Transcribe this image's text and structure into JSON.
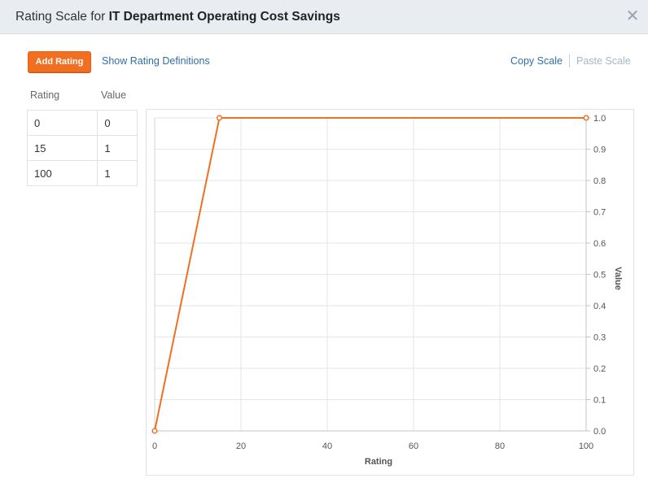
{
  "dialog": {
    "title_prefix": "Rating Scale for ",
    "title_bold": "IT Department Operating Cost Savings",
    "close_glyph": "✕"
  },
  "toolbar": {
    "add_rating_label": "Add Rating",
    "show_definitions_label": "Show Rating Definitions",
    "copy_scale_label": "Copy Scale",
    "paste_scale_label": "Paste Scale"
  },
  "table": {
    "headers": [
      "Rating",
      "Value"
    ],
    "rows": [
      {
        "rating": "0",
        "value": "0"
      },
      {
        "rating": "15",
        "value": "1"
      },
      {
        "rating": "100",
        "value": "1"
      }
    ]
  },
  "chart_data": {
    "type": "line",
    "xlabel": "Rating",
    "ylabel": "Value",
    "xlim": [
      0,
      100
    ],
    "ylim": [
      0,
      1
    ],
    "x_ticks": [
      "0",
      "20",
      "40",
      "60",
      "80",
      "100"
    ],
    "y_ticks": [
      "0.0",
      "0.1",
      "0.2",
      "0.3",
      "0.4",
      "0.5",
      "0.6",
      "0.7",
      "0.8",
      "0.9",
      "1.0"
    ],
    "grid": true,
    "y_axis_side": "right",
    "series": [
      {
        "color": "#f26f21",
        "x": [
          0,
          15,
          100
        ],
        "y": [
          0,
          1,
          1
        ]
      }
    ]
  }
}
